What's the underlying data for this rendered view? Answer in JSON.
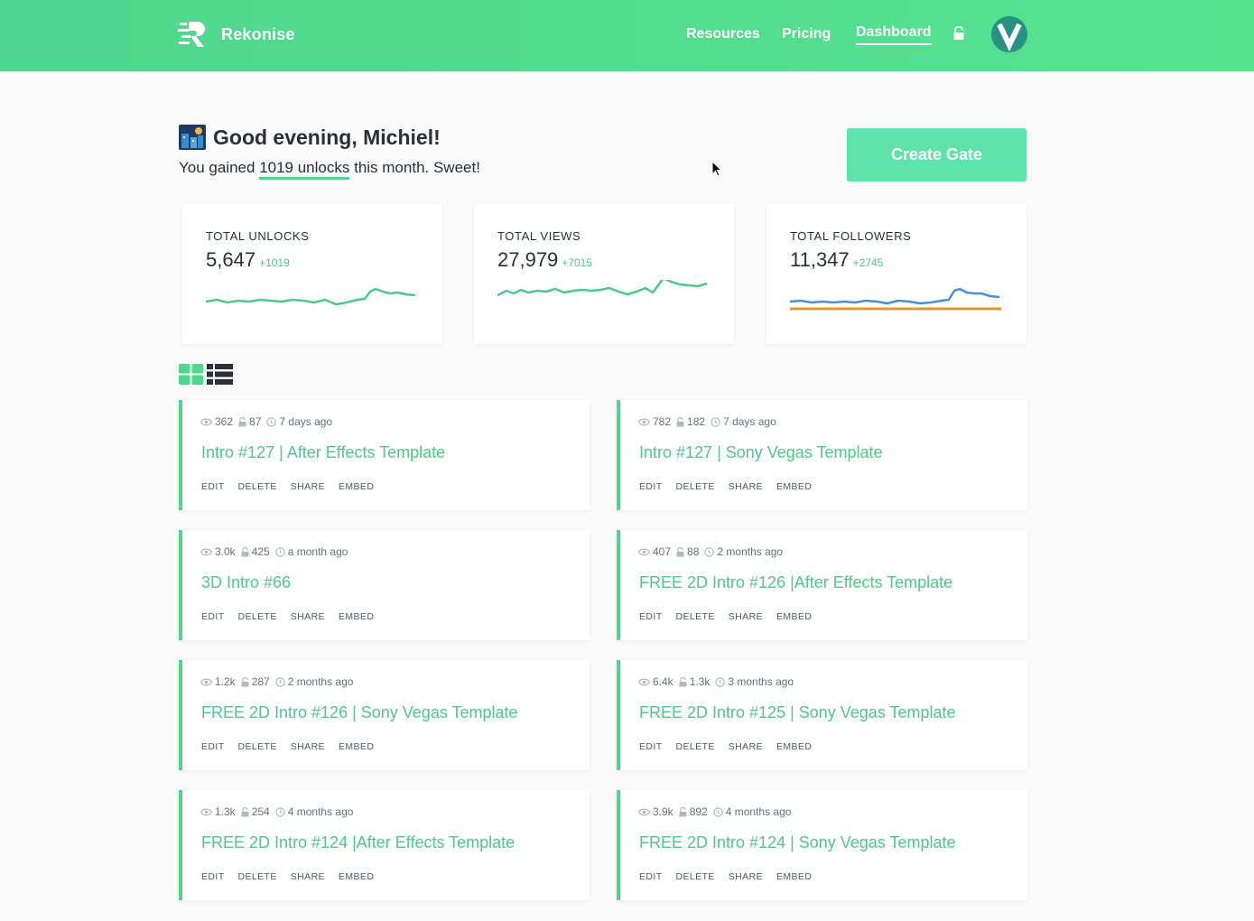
{
  "brand": {
    "name": "Rekonise"
  },
  "nav": {
    "resources": "Resources",
    "pricing": "Pricing",
    "dashboard": "Dashboard"
  },
  "avatar": {
    "initial": "V"
  },
  "greeting": {
    "title": "Good evening, Michiel!",
    "sub_prefix": "You gained ",
    "sub_highlight": "1019 unlocks",
    "sub_suffix": " this month. Sweet!"
  },
  "create_button": "Create Gate",
  "stats": [
    {
      "label": "TOTAL UNLOCKS",
      "value": "5,647",
      "delta": "+1019"
    },
    {
      "label": "TOTAL VIEWS",
      "value": "27,979",
      "delta": "+7015"
    },
    {
      "label": "TOTAL FOLLOWERS",
      "value": "11,347",
      "delta": "+2745"
    }
  ],
  "colors": {
    "accent": "#4fd68f",
    "title_green": "#4fc98a",
    "button": "#5ee3ab",
    "line_blue": "#4a8fd6",
    "line_orange": "#e09a2a"
  },
  "actions": {
    "edit": "EDIT",
    "delete": "DELETE",
    "share": "SHARE",
    "embed": "EMBED"
  },
  "gates": [
    {
      "views": "362",
      "unlocks": "87",
      "time": "7 days ago",
      "title": "Intro #127 | After Effects Template"
    },
    {
      "views": "782",
      "unlocks": "182",
      "time": "7 days ago",
      "title": "Intro #127 | Sony Vegas Template"
    },
    {
      "views": "3.0k",
      "unlocks": "425",
      "time": "a month ago",
      "title": "3D Intro #66"
    },
    {
      "views": "407",
      "unlocks": "88",
      "time": "2 months ago",
      "title": "FREE 2D Intro #126 |After Effects Template"
    },
    {
      "views": "1.2k",
      "unlocks": "287",
      "time": "2 months ago",
      "title": "FREE 2D Intro #126 | Sony Vegas Template"
    },
    {
      "views": "6.4k",
      "unlocks": "1.3k",
      "time": "3 months ago",
      "title": "FREE 2D Intro #125 | Sony Vegas Template"
    },
    {
      "views": "1.3k",
      "unlocks": "254",
      "time": "4 months ago",
      "title": "FREE 2D Intro #124 |After Effects Template"
    },
    {
      "views": "3.9k",
      "unlocks": "892",
      "time": "4 months ago",
      "title": "FREE 2D Intro #124 | Sony Vegas Template"
    }
  ]
}
